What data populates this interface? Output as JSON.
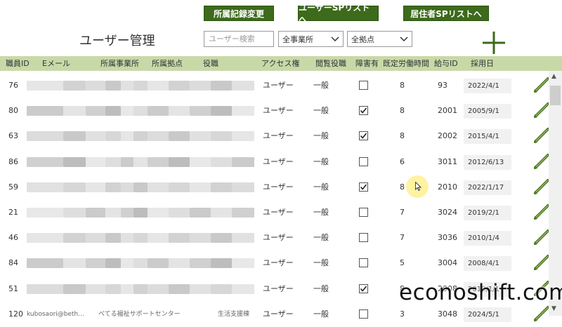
{
  "header": {
    "buttons": [
      "所属記録変更",
      "ユーザーSPリストへ",
      "居住者SPリストへ"
    ],
    "title": "ユーザー管理",
    "search_placeholder": "ユーザー検索",
    "filter_office": "全事業所",
    "filter_site": "全拠点"
  },
  "table": {
    "columns": [
      "職員ID",
      "Eメール",
      "所属事業所",
      "所属拠点",
      "役職",
      "アクセス権",
      "閲覧役職",
      "障害有",
      "既定労働時間",
      "給与ID",
      "採用日"
    ],
    "rows": [
      {
        "id": "76",
        "email": "",
        "office": "",
        "site": "",
        "role": "",
        "access": "ユーザー",
        "view": "一般",
        "disabled": false,
        "hours": "8",
        "pay_id": "93",
        "hired": "2022/4/1"
      },
      {
        "id": "80",
        "email": "",
        "office": "",
        "site": "",
        "role": "",
        "access": "ユーザー",
        "view": "一般",
        "disabled": true,
        "hours": "8",
        "pay_id": "2001",
        "hired": "2005/9/1"
      },
      {
        "id": "63",
        "email": "",
        "office": "",
        "site": "",
        "role": "",
        "access": "ユーザー",
        "view": "一般",
        "disabled": true,
        "hours": "8",
        "pay_id": "2002",
        "hired": "2015/4/1"
      },
      {
        "id": "86",
        "email": "",
        "office": "",
        "site": "",
        "role": "",
        "access": "ユーザー",
        "view": "一般",
        "disabled": false,
        "hours": "6",
        "pay_id": "3011",
        "hired": "2012/6/13"
      },
      {
        "id": "59",
        "email": "",
        "office": "",
        "site": "",
        "role": "",
        "access": "ユーザー",
        "view": "一般",
        "disabled": true,
        "hours": "8",
        "pay_id": "2010",
        "hired": "2022/1/17"
      },
      {
        "id": "21",
        "email": "",
        "office": "",
        "site": "",
        "role": "",
        "access": "ユーザー",
        "view": "一般",
        "disabled": false,
        "hours": "7",
        "pay_id": "3024",
        "hired": "2019/2/1"
      },
      {
        "id": "46",
        "email": "",
        "office": "",
        "site": "",
        "role": "",
        "access": "ユーザー",
        "view": "一般",
        "disabled": false,
        "hours": "7",
        "pay_id": "3036",
        "hired": "2010/1/4"
      },
      {
        "id": "84",
        "email": "",
        "office": "",
        "site": "",
        "role": "",
        "access": "ユーザー",
        "view": "一般",
        "disabled": false,
        "hours": "5",
        "pay_id": "3004",
        "hired": "2008/4/1"
      },
      {
        "id": "51",
        "email": "",
        "office": "",
        "site": "",
        "role": "",
        "access": "ユーザー",
        "view": "一般",
        "disabled": true,
        "hours": "8",
        "pay_id": "2008",
        "hired": "2019/1/1"
      },
      {
        "id": "120",
        "email": "kubosaori@beth...",
        "office": "べてる福祉サポートセンター",
        "site": "生活支援棟",
        "role": "",
        "access": "ユーザー",
        "view": "一般",
        "disabled": false,
        "hours": "3",
        "pay_id": "3048",
        "hired": "2024/5/1"
      }
    ]
  },
  "watermark": "econoshift.com",
  "colors": {
    "accent": "#3d6a1b",
    "header_bg": "#c8d9a8",
    "pencil": "#4f7a22"
  }
}
